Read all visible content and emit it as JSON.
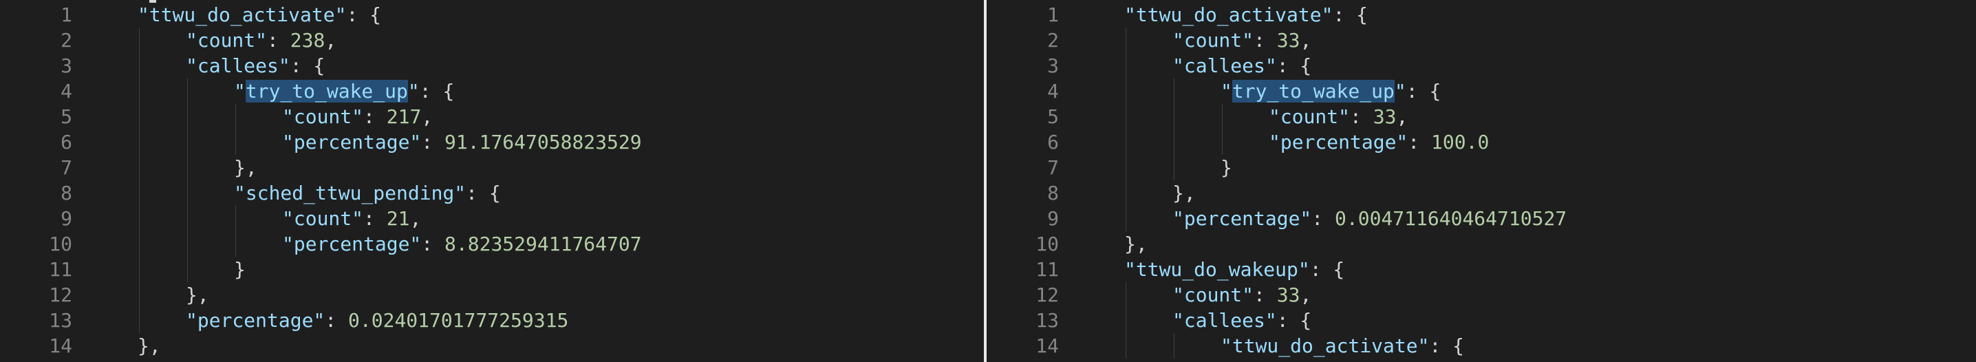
{
  "left_pane": {
    "lines": [
      {
        "n": "1",
        "indent": 1,
        "parts": [
          {
            "t": "\"ttwu_do_activate\"",
            "c": "key"
          },
          {
            "t": ": {",
            "c": "punc"
          }
        ]
      },
      {
        "n": "2",
        "indent": 2,
        "parts": [
          {
            "t": "\"count\"",
            "c": "key"
          },
          {
            "t": ": ",
            "c": "punc"
          },
          {
            "t": "238",
            "c": "num"
          },
          {
            "t": ",",
            "c": "punc"
          }
        ]
      },
      {
        "n": "3",
        "indent": 2,
        "parts": [
          {
            "t": "\"callees\"",
            "c": "key"
          },
          {
            "t": ": {",
            "c": "punc"
          }
        ]
      },
      {
        "n": "4",
        "indent": 3,
        "parts": [
          {
            "t": "\"",
            "c": "key"
          },
          {
            "t": "try_to_wake_up",
            "c": "key hl"
          },
          {
            "t": "\"",
            "c": "key"
          },
          {
            "t": ": {",
            "c": "punc"
          }
        ]
      },
      {
        "n": "5",
        "indent": 4,
        "parts": [
          {
            "t": "\"count\"",
            "c": "key"
          },
          {
            "t": ": ",
            "c": "punc"
          },
          {
            "t": "217",
            "c": "num"
          },
          {
            "t": ",",
            "c": "punc"
          }
        ]
      },
      {
        "n": "6",
        "indent": 4,
        "parts": [
          {
            "t": "\"percentage\"",
            "c": "key"
          },
          {
            "t": ": ",
            "c": "punc"
          },
          {
            "t": "91.17647058823529",
            "c": "num"
          }
        ]
      },
      {
        "n": "7",
        "indent": 3,
        "parts": [
          {
            "t": "},",
            "c": "punc"
          }
        ]
      },
      {
        "n": "8",
        "indent": 3,
        "parts": [
          {
            "t": "\"sched_ttwu_pending\"",
            "c": "key"
          },
          {
            "t": ": {",
            "c": "punc"
          }
        ]
      },
      {
        "n": "9",
        "indent": 4,
        "parts": [
          {
            "t": "\"count\"",
            "c": "key"
          },
          {
            "t": ": ",
            "c": "punc"
          },
          {
            "t": "21",
            "c": "num"
          },
          {
            "t": ",",
            "c": "punc"
          }
        ]
      },
      {
        "n": "10",
        "indent": 4,
        "parts": [
          {
            "t": "\"percentage\"",
            "c": "key"
          },
          {
            "t": ": ",
            "c": "punc"
          },
          {
            "t": "8.823529411764707",
            "c": "num"
          }
        ]
      },
      {
        "n": "11",
        "indent": 3,
        "parts": [
          {
            "t": "}",
            "c": "punc"
          }
        ]
      },
      {
        "n": "12",
        "indent": 2,
        "parts": [
          {
            "t": "},",
            "c": "punc"
          }
        ]
      },
      {
        "n": "13",
        "indent": 2,
        "parts": [
          {
            "t": "\"percentage\"",
            "c": "key"
          },
          {
            "t": ": ",
            "c": "punc"
          },
          {
            "t": "0.02401701777259315",
            "c": "num"
          }
        ]
      },
      {
        "n": "14",
        "indent": 1,
        "parts": [
          {
            "t": "},",
            "c": "punc"
          }
        ]
      }
    ]
  },
  "right_pane": {
    "lines": [
      {
        "n": "1",
        "indent": 1,
        "parts": [
          {
            "t": "\"ttwu_do_activate\"",
            "c": "key"
          },
          {
            "t": ": {",
            "c": "punc"
          }
        ]
      },
      {
        "n": "2",
        "indent": 2,
        "parts": [
          {
            "t": "\"count\"",
            "c": "key"
          },
          {
            "t": ": ",
            "c": "punc"
          },
          {
            "t": "33",
            "c": "num"
          },
          {
            "t": ",",
            "c": "punc"
          }
        ]
      },
      {
        "n": "3",
        "indent": 2,
        "parts": [
          {
            "t": "\"callees\"",
            "c": "key"
          },
          {
            "t": ": {",
            "c": "punc"
          }
        ]
      },
      {
        "n": "4",
        "indent": 3,
        "parts": [
          {
            "t": "\"",
            "c": "key"
          },
          {
            "t": "try_to_wake_up",
            "c": "key hl"
          },
          {
            "t": "\"",
            "c": "key"
          },
          {
            "t": ": {",
            "c": "punc"
          }
        ]
      },
      {
        "n": "5",
        "indent": 4,
        "parts": [
          {
            "t": "\"count\"",
            "c": "key"
          },
          {
            "t": ": ",
            "c": "punc"
          },
          {
            "t": "33",
            "c": "num"
          },
          {
            "t": ",",
            "c": "punc"
          }
        ]
      },
      {
        "n": "6",
        "indent": 4,
        "parts": [
          {
            "t": "\"percentage\"",
            "c": "key"
          },
          {
            "t": ": ",
            "c": "punc"
          },
          {
            "t": "100.0",
            "c": "num"
          }
        ]
      },
      {
        "n": "7",
        "indent": 3,
        "parts": [
          {
            "t": "}",
            "c": "punc"
          }
        ]
      },
      {
        "n": "8",
        "indent": 2,
        "parts": [
          {
            "t": "},",
            "c": "punc"
          }
        ]
      },
      {
        "n": "9",
        "indent": 2,
        "parts": [
          {
            "t": "\"percentage\"",
            "c": "key"
          },
          {
            "t": ": ",
            "c": "punc"
          },
          {
            "t": "0.004711640464710527",
            "c": "num"
          }
        ]
      },
      {
        "n": "10",
        "indent": 1,
        "parts": [
          {
            "t": "},",
            "c": "punc"
          }
        ]
      },
      {
        "n": "11",
        "indent": 1,
        "parts": [
          {
            "t": "\"ttwu_do_wakeup\"",
            "c": "key"
          },
          {
            "t": ": {",
            "c": "punc"
          }
        ]
      },
      {
        "n": "12",
        "indent": 2,
        "parts": [
          {
            "t": "\"count\"",
            "c": "key"
          },
          {
            "t": ": ",
            "c": "punc"
          },
          {
            "t": "33",
            "c": "num"
          },
          {
            "t": ",",
            "c": "punc"
          }
        ]
      },
      {
        "n": "13",
        "indent": 2,
        "parts": [
          {
            "t": "\"callees\"",
            "c": "key"
          },
          {
            "t": ": {",
            "c": "punc"
          }
        ]
      },
      {
        "n": "14",
        "indent": 3,
        "parts": [
          {
            "t": "\"ttwu_do_activate\"",
            "c": "key"
          },
          {
            "t": ": {",
            "c": "punc"
          }
        ]
      }
    ]
  },
  "colors": {
    "background": "#1e1e1e",
    "key": "#9cdcfe",
    "number": "#b5cea8",
    "line_number": "#858585",
    "selection_highlight": "#264f78"
  }
}
